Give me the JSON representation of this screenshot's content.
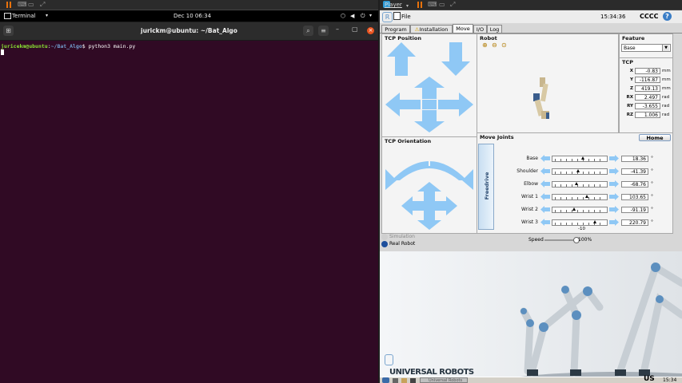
{
  "host": {
    "left_player_label": "Player",
    "ubuntu": {
      "terminal_menu": "Terminal",
      "clock": "Dec 10  06:34"
    },
    "terminal": {
      "title": "jurickm@ubuntu: ~/Bat_Algo",
      "prompt_user": "juricekm@ubuntu",
      "prompt_sep": ":",
      "prompt_path": "~/Bat_Algo",
      "prompt_dollar": "$ ",
      "command": "python3 main.py"
    }
  },
  "ur": {
    "menu_file": "File",
    "time": "15:34:36",
    "robot_name": "CCCC",
    "help_icon": "?",
    "tabs": [
      "Program",
      "Installation",
      "Move",
      "I/O",
      "Log"
    ],
    "active_tab": "Move",
    "tcp_position_title": "TCP Position",
    "robot_title": "Robot",
    "feature_title": "Feature",
    "feature_value": "Base",
    "tcp_title": "TCP",
    "tcp": [
      {
        "axis": "X",
        "value": "-0.83",
        "unit": "mm"
      },
      {
        "axis": "Y",
        "value": "-116.87",
        "unit": "mm"
      },
      {
        "axis": "Z",
        "value": "419.13",
        "unit": "mm"
      },
      {
        "axis": "RX",
        "value": "2.497",
        "unit": "rad"
      },
      {
        "axis": "RY",
        "value": "-3.655",
        "unit": "rad"
      },
      {
        "axis": "RZ",
        "value": "1.006",
        "unit": "rad"
      }
    ],
    "tcp_orientation_title": "TCP Orientation",
    "move_joints_title": "Move Joints",
    "home_label": "Home",
    "freedrive_label": "Freedrive",
    "joints": [
      {
        "name": "Base",
        "value": "18.36",
        "unit": "°",
        "level": 0.55
      },
      {
        "name": "Shoulder",
        "value": "-41.39",
        "unit": "°",
        "level": 0.45
      },
      {
        "name": "Elbow",
        "value": "-68.76",
        "unit": "°",
        "level": 0.42
      },
      {
        "name": "Wrist 1",
        "value": "103.65",
        "unit": "°",
        "level": 0.64
      },
      {
        "name": "Wrist 2",
        "value": "-91.19",
        "unit": "°",
        "level": 0.37
      },
      {
        "name": "Wrist 3",
        "value": "220.79",
        "unit": "°",
        "level": 0.8
      }
    ],
    "slider_min_label": "-10",
    "simulation_label": "Simulation",
    "real_robot_label": "Real Robot",
    "speed_label": "Speed",
    "speed_value": "100%",
    "speed_level": 1.0,
    "brand_text": "UNIVERSAL ROBOTS",
    "taskbar_item": "Universal Robots",
    "taskbar_lang": "US",
    "taskbar_time": "15:34"
  },
  "colors": {
    "terminal_bg": "#300a24",
    "prompt_user": "#8ae234",
    "prompt_path": "#729fcf",
    "arrow_blue": "#8fc8f5"
  }
}
